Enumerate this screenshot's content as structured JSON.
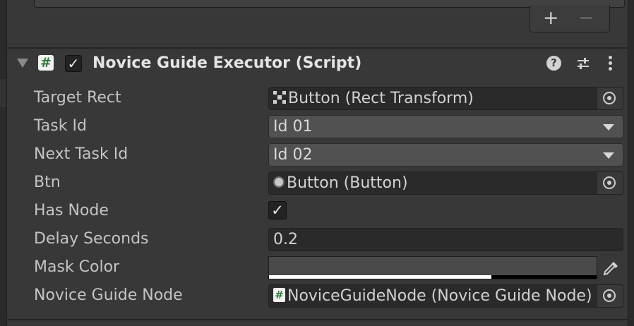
{
  "list_footer": {
    "add_label": "+",
    "remove_label": "−"
  },
  "component": {
    "title": "Novice Guide Executor (Script)",
    "script_icon_glyph": "#",
    "enabled": true,
    "enabled_glyph": "✓",
    "help_glyph": "?"
  },
  "fields": {
    "target_rect": {
      "label": "Target Rect",
      "value": "Button (Rect Transform)",
      "icon": "rect-transform-icon"
    },
    "task_id": {
      "label": "Task Id",
      "value": "Id 01"
    },
    "next_task_id": {
      "label": "Next Task Id",
      "value": "Id 02"
    },
    "btn": {
      "label": "Btn",
      "value": "Button (Button)",
      "icon": "button-component-icon"
    },
    "has_node": {
      "label": "Has Node",
      "checked": true,
      "glyph": "✓"
    },
    "delay_seconds": {
      "label": "Delay Seconds",
      "value": "0.2"
    },
    "mask_color": {
      "label": "Mask Color",
      "color": "#4a4a4a",
      "alpha": 0.7
    },
    "novice_guide_node": {
      "label": "Novice Guide Node",
      "value": "NoviceGuideNode (Novice Guide Node)",
      "icon_glyph": "#"
    }
  },
  "colors": {
    "background": "#383838",
    "field_dark": "#2a2a2a",
    "popup": "#515151",
    "text": "#c4c4c4",
    "script_icon_green": "#2f7c3c"
  }
}
